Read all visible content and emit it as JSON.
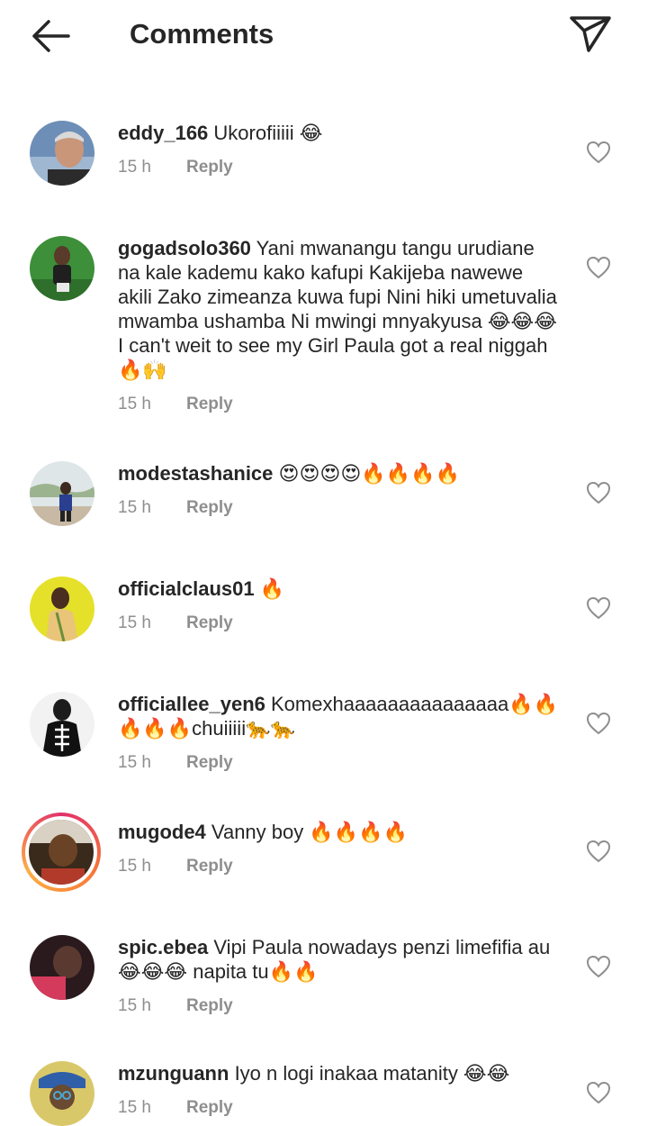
{
  "header": {
    "title": "Comments",
    "back_icon": "arrow-left-icon",
    "send_icon": "paper-plane-icon"
  },
  "reply_label": "Reply",
  "comments": [
    {
      "username": "eddy_166",
      "text": "Ukorofiiiii 😂",
      "time": "15 h"
    },
    {
      "username": "gogadsolo360",
      "text": "Yani mwanangu tangu urudiane na kale kademu kako kafupi Kakijeba nawewe akili Zako zimeanza kuwa fupi Nini hiki umetuvalia mwamba ushamba Ni mwingi mnyakyusa 😂😂😂 I can't weit to see my Girl Paula got a real niggah 🔥🙌",
      "time": "15 h"
    },
    {
      "username": "modestashanice",
      "text": "😍😍😍😍🔥🔥🔥🔥",
      "time": "15 h"
    },
    {
      "username": "officialclaus01",
      "text": "🔥",
      "time": "15 h"
    },
    {
      "username": "officiallee_yen6",
      "text": "Komexhaaaaaaaaaaaaaaa🔥🔥🔥🔥🔥chuiiiii🐆🐆",
      "time": "15 h"
    },
    {
      "username": "mugode4",
      "text": "Vanny boy 🔥🔥🔥🔥",
      "time": "15 h"
    },
    {
      "username": "spic.ebea",
      "text": "Vipi Paula nowadays penzi limefifia au😂😂😂 napita tu🔥🔥",
      "time": "15 h"
    },
    {
      "username": "mzunguann",
      "text": "Iyo n logi inakaa matanity 😂😂",
      "time": "15 h"
    }
  ]
}
